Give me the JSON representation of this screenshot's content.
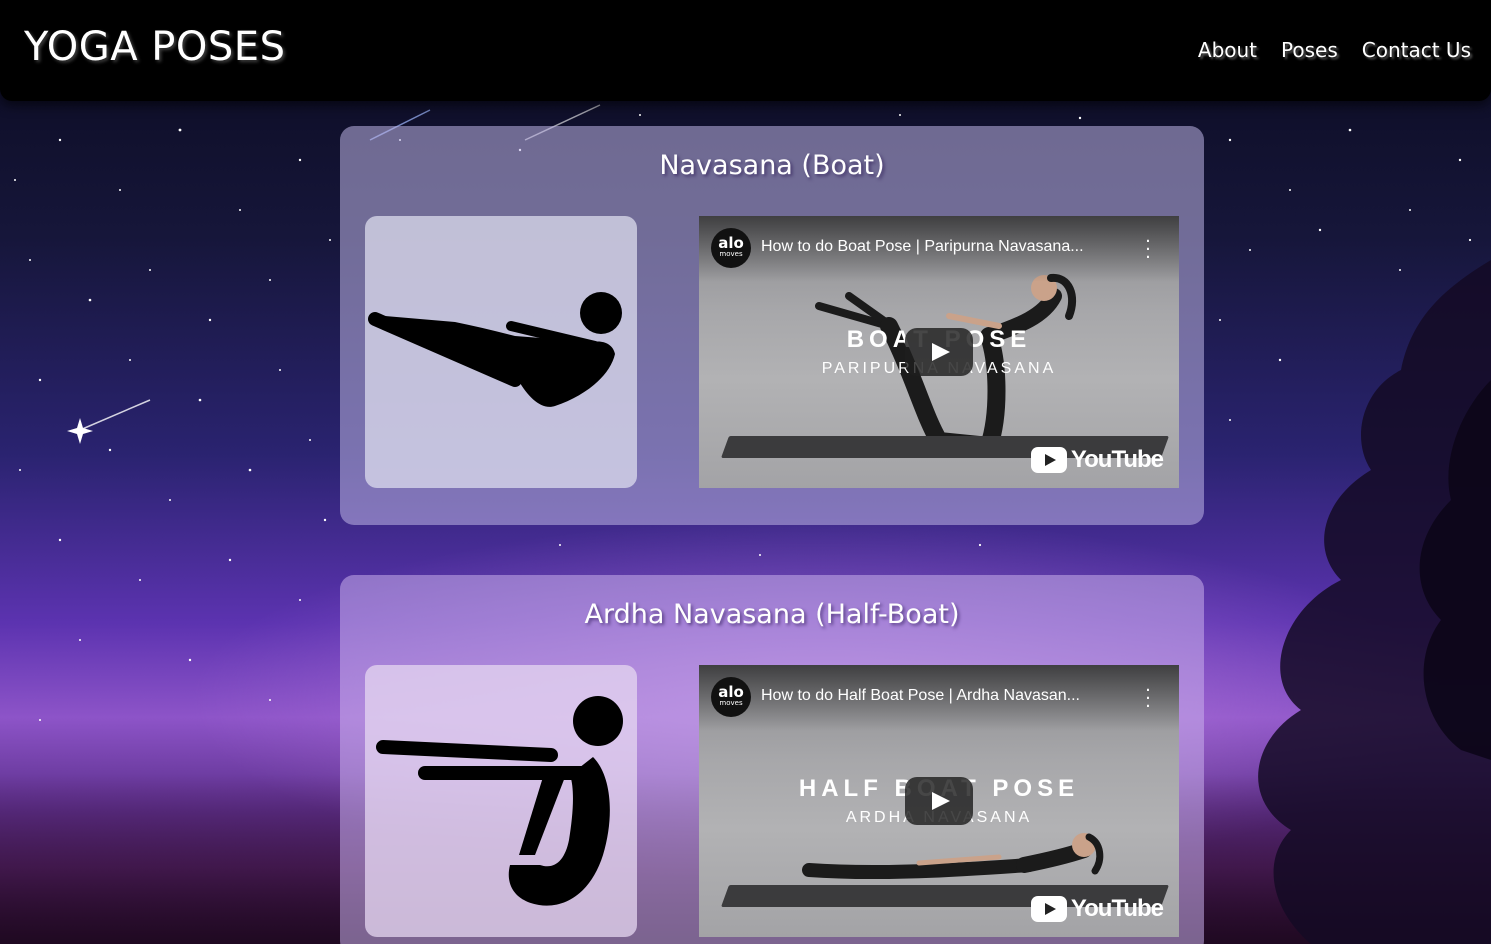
{
  "header": {
    "brand": "YOGA POSES",
    "nav": [
      {
        "label": "About"
      },
      {
        "label": "Poses"
      },
      {
        "label": "Contact Us"
      }
    ]
  },
  "poses": [
    {
      "title": "Navasana (Boat)",
      "icon": "boat-pose-icon",
      "video": {
        "channel": "alo",
        "channel_sub": "moves",
        "title": "How to do Boat Pose | Paripurna Navasana...",
        "overlay_line1": "BOAT POSE",
        "overlay_line2": "PARIPURNA NAVASANA",
        "platform": "YouTube"
      }
    },
    {
      "title": "Ardha Navasana (Half-Boat)",
      "icon": "half-boat-pose-icon",
      "video": {
        "channel": "alo",
        "channel_sub": "moves",
        "title": "How to do Half Boat Pose | Ardha Navasan...",
        "overlay_line1": "HALF BOAT POSE",
        "overlay_line2": "ARDHA NAVASANA",
        "platform": "YouTube"
      }
    }
  ],
  "colors": {
    "header_bg": "#000000",
    "card_bg": "#beb4e6",
    "text": "#ffffff"
  }
}
